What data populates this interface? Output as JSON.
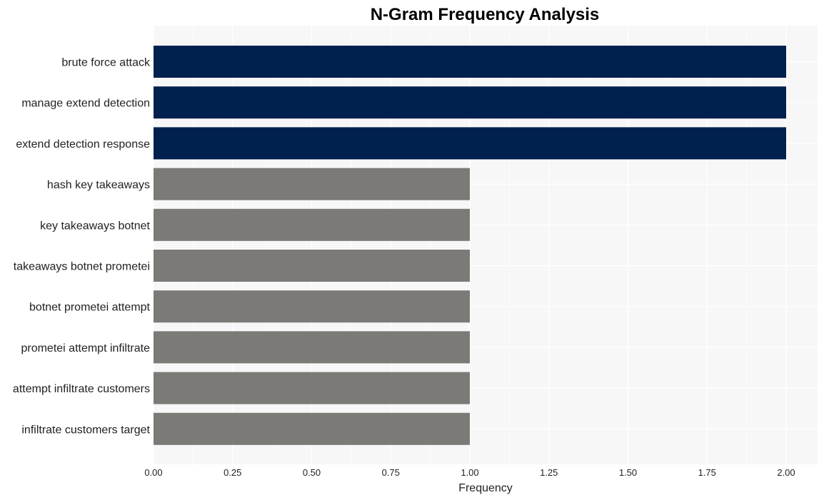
{
  "chart_data": {
    "type": "bar",
    "orientation": "horizontal",
    "title": "N-Gram Frequency Analysis",
    "xlabel": "Frequency",
    "ylabel": "",
    "xlim": [
      0,
      2.1
    ],
    "xticks": [
      0.0,
      0.25,
      0.5,
      0.75,
      1.0,
      1.25,
      1.5,
      1.75,
      2.0
    ],
    "xtick_labels": [
      "0.00",
      "0.25",
      "0.50",
      "0.75",
      "1.00",
      "1.25",
      "1.50",
      "1.75",
      "2.00"
    ],
    "grid": true,
    "categories": [
      "brute force attack",
      "manage extend detection",
      "extend detection response",
      "hash key takeaways",
      "key takeaways botnet",
      "takeaways botnet prometei",
      "botnet prometei attempt",
      "prometei attempt infiltrate",
      "attempt infiltrate customers",
      "infiltrate customers target"
    ],
    "values": [
      2,
      2,
      2,
      1,
      1,
      1,
      1,
      1,
      1,
      1
    ],
    "colors": {
      "highlight": "#00204e",
      "default": "#7b7a76",
      "plot_background": "#f7f7f7",
      "grid": "#ffffff"
    }
  }
}
